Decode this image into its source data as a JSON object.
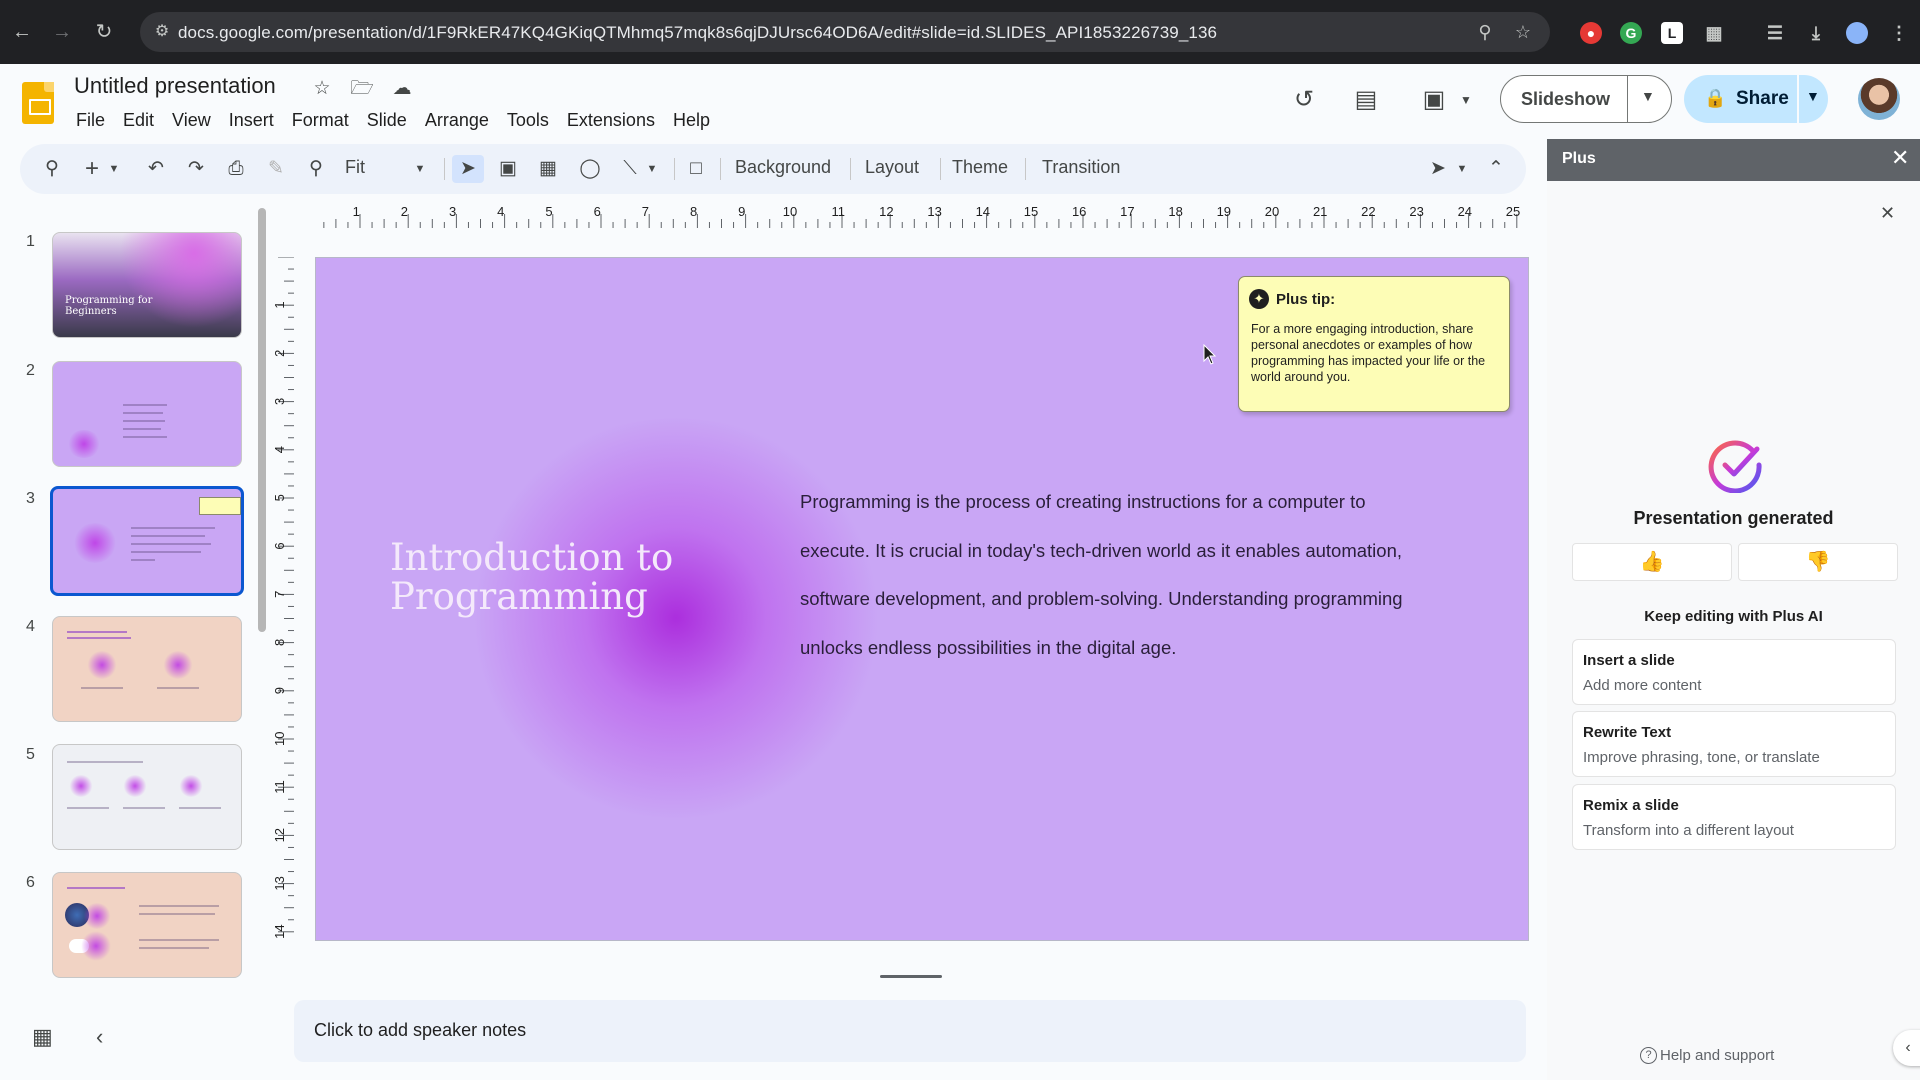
{
  "browser": {
    "url": "docs.google.com/presentation/d/1F9RkER47KQ4GKiqQTMhmq57mqk8s6qjDJUrsc64OD6A/edit#slide=id.SLIDES_API1853226739_136"
  },
  "header": {
    "title": "Untitled presentation",
    "menu": [
      "File",
      "Edit",
      "View",
      "Insert",
      "Format",
      "Slide",
      "Arrange",
      "Tools",
      "Extensions",
      "Help"
    ],
    "slideshow_label": "Slideshow",
    "share_label": "Share"
  },
  "toolbar": {
    "zoom": "Fit",
    "background": "Background",
    "layout": "Layout",
    "theme": "Theme",
    "transition": "Transition"
  },
  "filmstrip": {
    "slides": [
      {
        "num": "1",
        "title": "Programming for Beginners"
      },
      {
        "num": "2"
      },
      {
        "num": "3"
      },
      {
        "num": "4"
      },
      {
        "num": "5"
      },
      {
        "num": "6"
      }
    ],
    "selected": 3
  },
  "rulers": {
    "horizontal": [
      "1",
      "2",
      "3",
      "4",
      "5",
      "6",
      "7",
      "8",
      "9",
      "10",
      "11",
      "12",
      "13",
      "14",
      "15",
      "16",
      "17",
      "18",
      "19",
      "20",
      "21",
      "22",
      "23",
      "24",
      "25"
    ],
    "vertical": [
      "1",
      "2",
      "3",
      "4",
      "5",
      "6",
      "7",
      "8",
      "9",
      "10",
      "11",
      "12",
      "13",
      "14"
    ]
  },
  "slide": {
    "heading": "Introduction to Programming",
    "body": "Programming is the process of creating instructions for a computer to execute. It is crucial in today's tech-driven world as it enables automation, software development, and problem-solving. Understanding programming unlocks endless possibilities in the digital age.",
    "tip_title": "Plus tip:",
    "tip_body": "For a more engaging introduction, share personal anecdotes or examples of how programming has impacted your life or the world around you."
  },
  "notes": {
    "placeholder": "Click to add speaker notes"
  },
  "panel": {
    "title": "Plus",
    "status": "Presentation generated",
    "keep_editing": "Keep editing with Plus AI",
    "cards": [
      {
        "title": "Insert a slide",
        "subtitle": "Add more content"
      },
      {
        "title": "Rewrite Text",
        "subtitle": "Improve phrasing, tone, or translate"
      },
      {
        "title": "Remix a slide",
        "subtitle": "Transform into a different layout"
      }
    ],
    "help": "Help and support"
  },
  "colors": {
    "slide_bg": "#c9a6f5",
    "accent": "#0b57d0",
    "share_bg": "#c2e7ff",
    "tip_bg": "#fdfdb6"
  }
}
